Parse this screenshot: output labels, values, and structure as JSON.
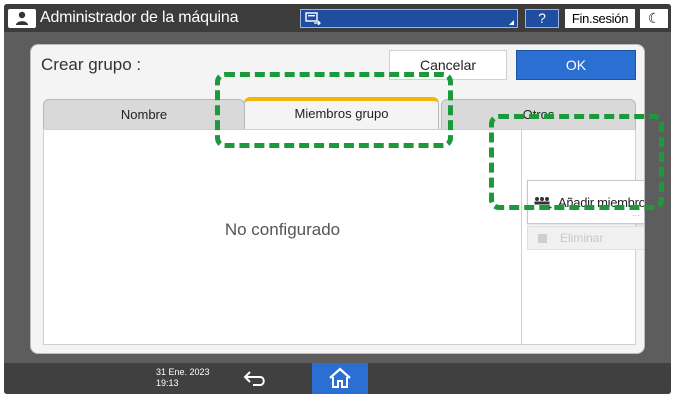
{
  "topbar": {
    "title": "Administrador de la máquina",
    "help_label": "?",
    "logout_label": "Fin.sesión",
    "sleep_label": "☾",
    "user_icon": "user-icon",
    "field_icon": "screen-switch-icon"
  },
  "dialog": {
    "title": "Crear grupo :",
    "cancel_label": "Cancelar",
    "ok_label": "OK",
    "tabs": [
      {
        "label": "Nombre",
        "selected": false
      },
      {
        "label": "Miembros grupo",
        "selected": true
      },
      {
        "label": "Otros",
        "selected": false
      }
    ],
    "empty_message": "No configurado",
    "add_member_label": "Añadir miembro",
    "add_member_icon": "add-users-icon",
    "delete_label": "Eliminar"
  },
  "bottombar": {
    "date": "31 Ene. 2023",
    "time": "19:13",
    "back_icon": "back-arrow-icon",
    "home_icon": "home-icon"
  },
  "colors": {
    "highlight": "#1b9a3b",
    "accent_blue": "#2a6fd1",
    "selected_tab": "#f2b705"
  }
}
